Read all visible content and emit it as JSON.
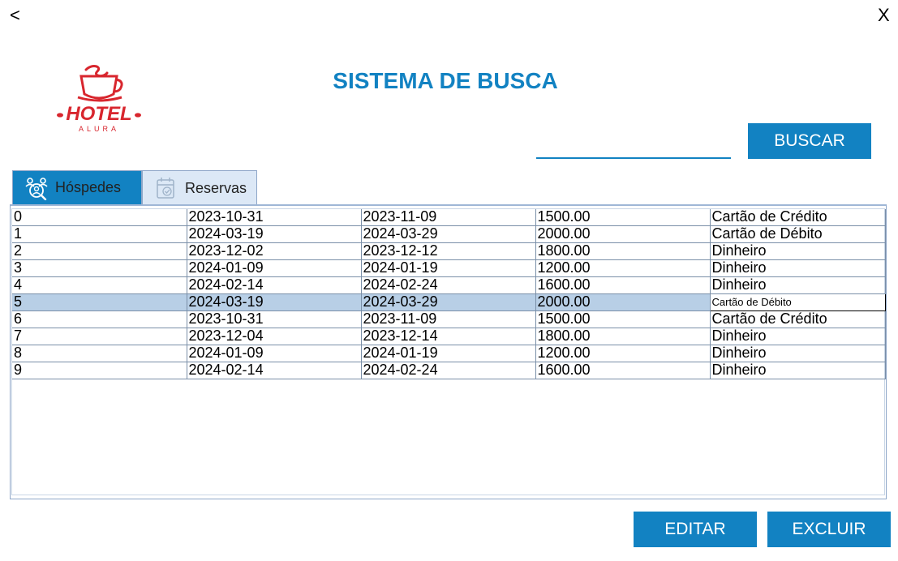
{
  "window": {
    "back_label": "<",
    "close_label": "X"
  },
  "logo": {
    "text_main": "HOTEL",
    "text_sub": "ALURA"
  },
  "header": {
    "title": "SISTEMA DE BUSCA"
  },
  "search": {
    "value": "",
    "button_label": "BUSCAR"
  },
  "tabs": [
    {
      "label": "Hóspedes",
      "icon": "guests-icon"
    },
    {
      "label": "Reservas",
      "icon": "calendar-icon",
      "active": true
    }
  ],
  "table": {
    "selected_row": 5,
    "rows": [
      [
        "0",
        "2023-10-31",
        "2023-11-09",
        "1500.00",
        "Cartão de Crédito"
      ],
      [
        "1",
        "2024-03-19",
        "2024-03-29",
        "2000.00",
        "Cartão de Débito"
      ],
      [
        "2",
        "2023-12-02",
        "2023-12-12",
        "1800.00",
        "Dinheiro"
      ],
      [
        "3",
        "2024-01-09",
        "2024-01-19",
        "1200.00",
        "Dinheiro"
      ],
      [
        "4",
        "2024-02-14",
        "2024-02-24",
        "1600.00",
        "Dinheiro"
      ],
      [
        "5",
        "2024-03-19",
        "2024-03-29",
        "2000.00",
        "Cartão de Débito"
      ],
      [
        "6",
        "2023-10-31",
        "2023-11-09",
        "1500.00",
        "Cartão de Crédito"
      ],
      [
        "7",
        "2023-12-04",
        "2023-12-14",
        "1800.00",
        "Dinheiro"
      ],
      [
        "8",
        "2024-01-09",
        "2024-01-19",
        "1200.00",
        "Dinheiro"
      ],
      [
        "9",
        "2024-02-14",
        "2024-02-24",
        "1600.00",
        "Dinheiro"
      ]
    ]
  },
  "actions": {
    "edit_label": "EDITAR",
    "delete_label": "EXCLUIR"
  },
  "colors": {
    "accent": "#1282c2",
    "logo_red": "#d8262e",
    "selected_row": "#b8cfe6"
  }
}
